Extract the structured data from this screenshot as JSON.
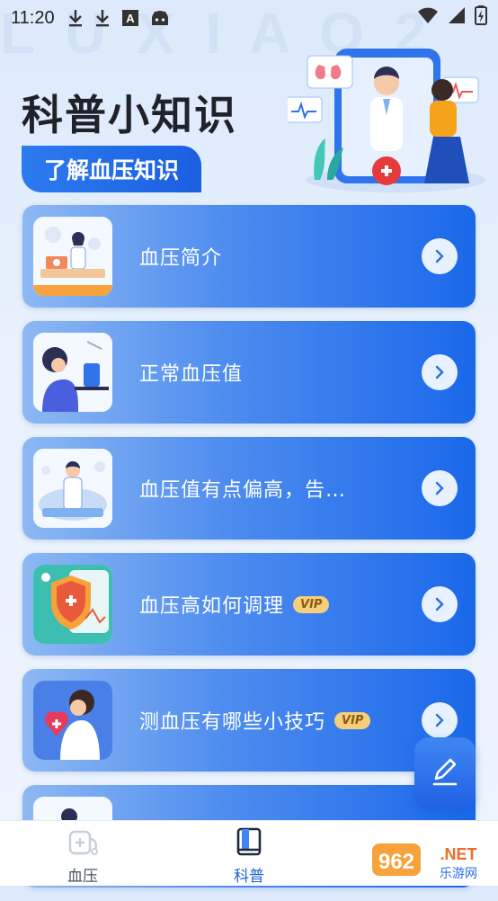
{
  "status_bar": {
    "time": "11:20",
    "icons": [
      "download-icon",
      "download-icon",
      "text-a-icon",
      "android-icon"
    ],
    "right_icons": [
      "wifi-icon",
      "signal-icon",
      "battery-icon"
    ]
  },
  "header": {
    "title": "科普小知识",
    "subtitle": "了解血压知识"
  },
  "cards": [
    {
      "label": "血压简介",
      "vip": ""
    },
    {
      "label": "正常血压值",
      "vip": ""
    },
    {
      "label": "血压值有点偏高，告…",
      "vip": ""
    },
    {
      "label": "血压高如何调理",
      "vip": "VIP"
    },
    {
      "label": "测血压有哪些小技巧",
      "vip": "VIP"
    }
  ],
  "tabbar": {
    "tabs": [
      {
        "label": "血压",
        "icon": "stethoscope-icon",
        "active": false
      },
      {
        "label": "科普",
        "icon": "book-icon",
        "active": true
      }
    ]
  },
  "brand": {
    "text": "962.NET",
    "sub": "乐游网"
  },
  "colors": {
    "accent": "#1a68ea",
    "active_tab": "#1f5fd6",
    "inactive_tab": "#4a5563"
  }
}
